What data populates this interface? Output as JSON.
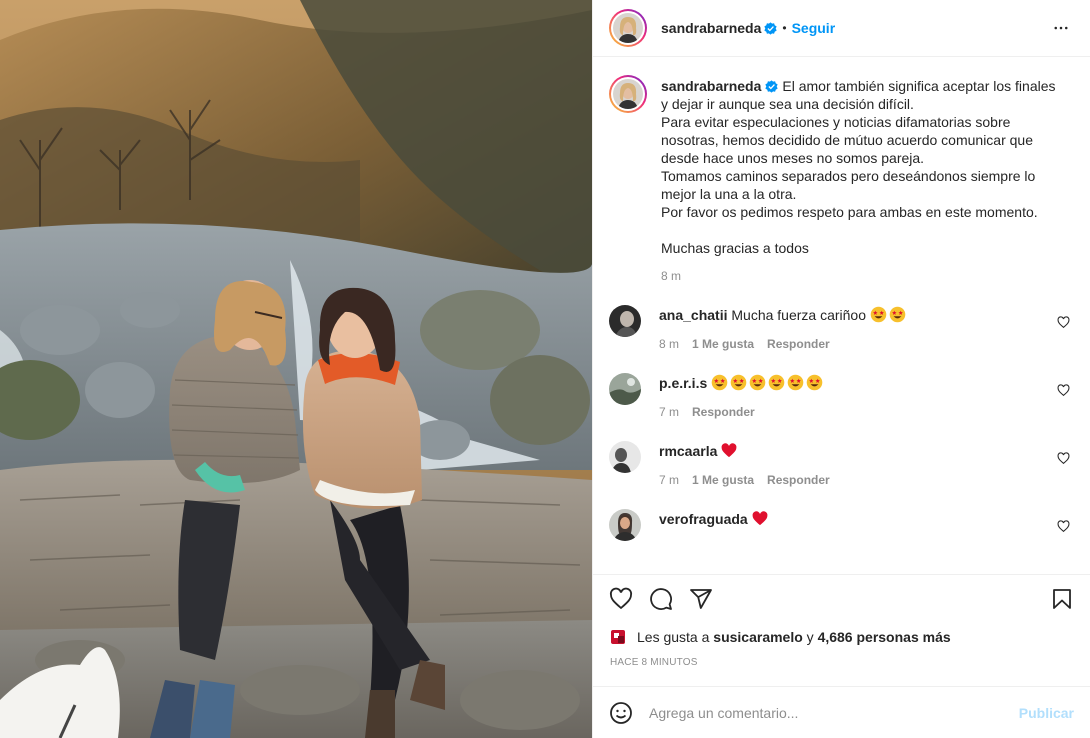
{
  "post": {
    "author": "sandrabarneda",
    "follow_label": "Seguir",
    "separator": "•",
    "icons": {
      "verified": "verified-badge-icon",
      "more": "more-options-icon",
      "like": "heart-icon",
      "comment": "comment-icon",
      "share": "paper-plane-icon",
      "save": "bookmark-icon",
      "emoji": "smiley-icon"
    },
    "colors": {
      "accent": "#0095f6",
      "text": "#262626",
      "muted": "#8e8e8e",
      "border": "#efefef",
      "heart": "#ed4956"
    }
  },
  "caption": {
    "username": "sandrabarneda",
    "text": "El amor también significa aceptar los finales y dejar ir aunque sea una decisión difícil.\nPara evitar especulaciones y noticias difamatorias sobre nosotras, hemos decidido de mútuo acuerdo comunicar que desde hace unos meses no somos pareja.\nTomamos caminos separados pero deseándonos siempre lo mejor la una a la otra.\nPor favor os pedimos respeto para ambas en este momento.\n\nMuchas gracias a todos",
    "time": "8 m"
  },
  "comments": [
    {
      "username": "ana_chatii",
      "text": "Mucha fuerza cariñoo",
      "emoji_count": 2,
      "emoji": "star-struck",
      "time": "8 m",
      "likes": "1 Me gusta",
      "reply": "Responder"
    },
    {
      "username": "p.e.r.i.s",
      "text": "",
      "emoji_count": 6,
      "emoji": "star-struck",
      "time": "7 m",
      "likes": "",
      "reply": "Responder"
    },
    {
      "username": "rmcaarla",
      "text": "",
      "emoji_count": 0,
      "emoji": "red-heart",
      "time": "7 m",
      "likes": "1 Me gusta",
      "reply": "Responder"
    },
    {
      "username": "verofraguada",
      "text": "",
      "emoji_count": 0,
      "emoji": "red-heart",
      "time": "",
      "likes": "",
      "reply": ""
    }
  ],
  "likes": {
    "prefix": "Les gusta a",
    "first_user": "susicaramelo",
    "connector": "y",
    "others": "4,686 personas más"
  },
  "time_ago": "HACE 8 MINUTOS",
  "add_comment": {
    "placeholder": "Agrega un comentario...",
    "publish_label": "Publicar"
  }
}
